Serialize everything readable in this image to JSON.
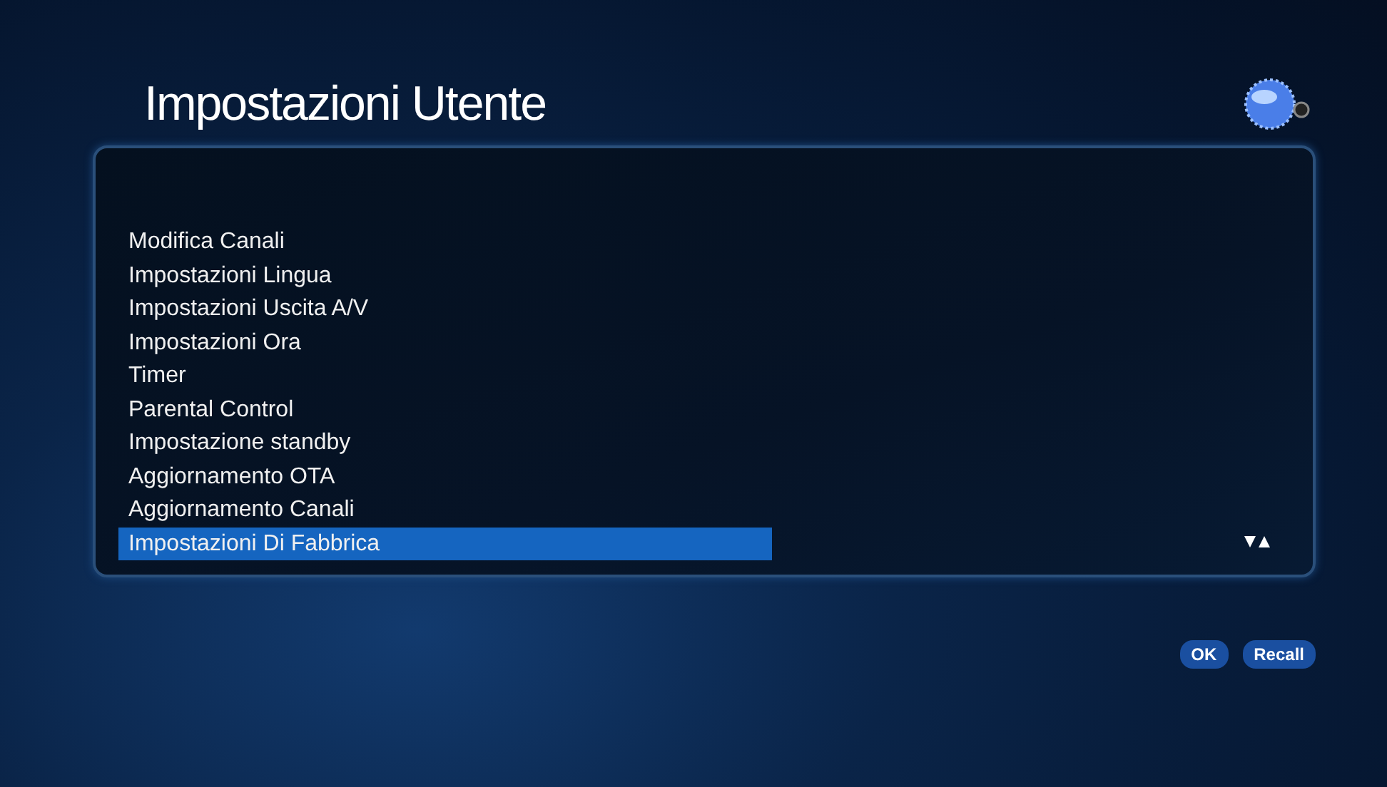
{
  "title": "Impostazioni Utente",
  "menu": [
    {
      "label": "Modifica Canali",
      "selected": false
    },
    {
      "label": "Impostazioni Lingua",
      "selected": false
    },
    {
      "label": "Impostazioni Uscita A/V",
      "selected": false
    },
    {
      "label": "Impostazioni Ora",
      "selected": false
    },
    {
      "label": "Timer",
      "selected": false
    },
    {
      "label": "Parental Control",
      "selected": false
    },
    {
      "label": "Impostazione standby",
      "selected": false
    },
    {
      "label": "Aggiornamento OTA",
      "selected": false
    },
    {
      "label": "Aggiornamento Canali",
      "selected": false
    },
    {
      "label": "Impostazioni Di Fabbrica",
      "selected": true
    }
  ],
  "buttons": [
    "OK",
    "Recall"
  ]
}
